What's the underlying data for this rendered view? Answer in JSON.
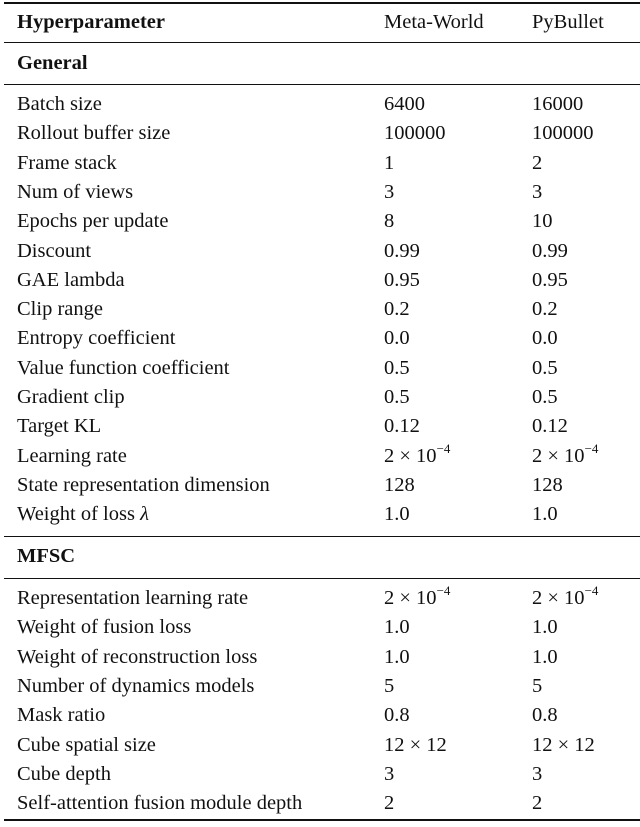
{
  "header": {
    "col1": "Hyperparameter",
    "col2": "Meta-World",
    "col3": "PyBullet"
  },
  "sections": [
    {
      "title": "General",
      "rows": [
        {
          "name": "Batch size",
          "metaworld": "6400",
          "pybullet": "16000"
        },
        {
          "name": "Rollout buffer size",
          "metaworld": "100000",
          "pybullet": "100000"
        },
        {
          "name": "Frame stack",
          "metaworld": "1",
          "pybullet": "2"
        },
        {
          "name": "Num of views",
          "metaworld": "3",
          "pybullet": "3"
        },
        {
          "name": "Epochs per update",
          "metaworld": "8",
          "pybullet": "10"
        },
        {
          "name": "Discount",
          "metaworld": "0.99",
          "pybullet": "0.99"
        },
        {
          "name": "GAE lambda",
          "metaworld": "0.95",
          "pybullet": "0.95"
        },
        {
          "name": "Clip range",
          "metaworld": "0.2",
          "pybullet": "0.2"
        },
        {
          "name": "Entropy coefficient",
          "metaworld": "0.0",
          "pybullet": "0.0"
        },
        {
          "name": "Value function coefficient",
          "metaworld": "0.5",
          "pybullet": "0.5"
        },
        {
          "name": "Gradient clip",
          "metaworld": "0.5",
          "pybullet": "0.5"
        },
        {
          "name": "Target KL",
          "metaworld": "0.12",
          "pybullet": "0.12"
        },
        {
          "name": "Learning rate",
          "metaworld": "2 × 10",
          "metaworld_exp": "−4",
          "pybullet": "2 × 10",
          "pybullet_exp": "−4"
        },
        {
          "name": "State representation dimension",
          "metaworld": "128",
          "pybullet": "128"
        },
        {
          "name": "Weight of loss ",
          "name_sym": "λ",
          "metaworld": "1.0",
          "pybullet": "1.0"
        }
      ]
    },
    {
      "title": "MFSC",
      "rows": [
        {
          "name": "Representation learning rate",
          "metaworld": "2 × 10",
          "metaworld_exp": "−4",
          "pybullet": "2 × 10",
          "pybullet_exp": "−4"
        },
        {
          "name": "Weight of fusion loss",
          "metaworld": "1.0",
          "pybullet": "1.0"
        },
        {
          "name": "Weight of reconstruction loss",
          "metaworld": "1.0",
          "pybullet": "1.0"
        },
        {
          "name": "Number of dynamics models",
          "metaworld": "5",
          "pybullet": "5"
        },
        {
          "name": "Mask ratio",
          "metaworld": "0.8",
          "pybullet": "0.8"
        },
        {
          "name": "Cube spatial size",
          "metaworld": "12 × 12",
          "pybullet": "12 × 12"
        },
        {
          "name": "Cube depth",
          "metaworld": "3",
          "pybullet": "3"
        },
        {
          "name": "Self-attention fusion module depth",
          "metaworld": "2",
          "pybullet": "2"
        }
      ]
    }
  ]
}
